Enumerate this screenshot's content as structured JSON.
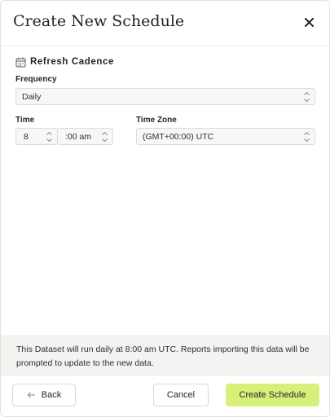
{
  "header": {
    "title": "Create New Schedule",
    "close_icon": "close-icon"
  },
  "section": {
    "title": "Refresh Cadence",
    "icon": "calendar-icon"
  },
  "frequency": {
    "label": "Frequency",
    "value": "Daily"
  },
  "time": {
    "label": "Time",
    "hour": "8",
    "minute": ":00 am"
  },
  "timezone": {
    "label": "Time Zone",
    "value": "(GMT+00:00) UTC"
  },
  "info": {
    "text": "This Dataset will run daily at 8:00 am UTC. Reports importing this data will be prompted to update to the new data."
  },
  "footer": {
    "back_label": "Back",
    "cancel_label": "Cancel",
    "create_label": "Create Schedule"
  },
  "colors": {
    "accent": "#d7f07a",
    "info_band": "#f3f3f1",
    "field_bg": "#f7f7f5"
  }
}
